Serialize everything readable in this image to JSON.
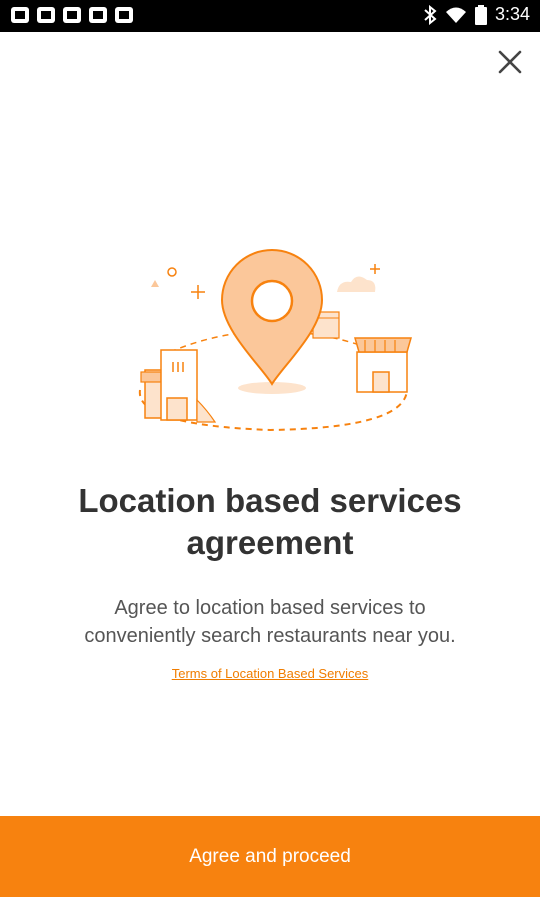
{
  "status_bar": {
    "time": "3:34",
    "left_icons": [
      "app-notification-icon",
      "app-notification-icon",
      "app-notification-icon",
      "app-notification-icon",
      "app-notification-icon"
    ],
    "right_icons": [
      "bluetooth-icon",
      "wifi-icon",
      "battery-icon"
    ]
  },
  "dialog": {
    "close_icon": "close-icon",
    "illustration": "location-pin-illustration",
    "title_line1": "Location based services",
    "title_line2": "agreement",
    "description_line1": "Agree to location based services to",
    "description_line2": "conveniently search restaurants near you.",
    "terms_link": "Terms of Location Based Services",
    "agree_button": "Agree and proceed"
  },
  "colors": {
    "accent": "#f7820f",
    "link": "#f07d00",
    "title": "#333333",
    "text": "#555555"
  }
}
